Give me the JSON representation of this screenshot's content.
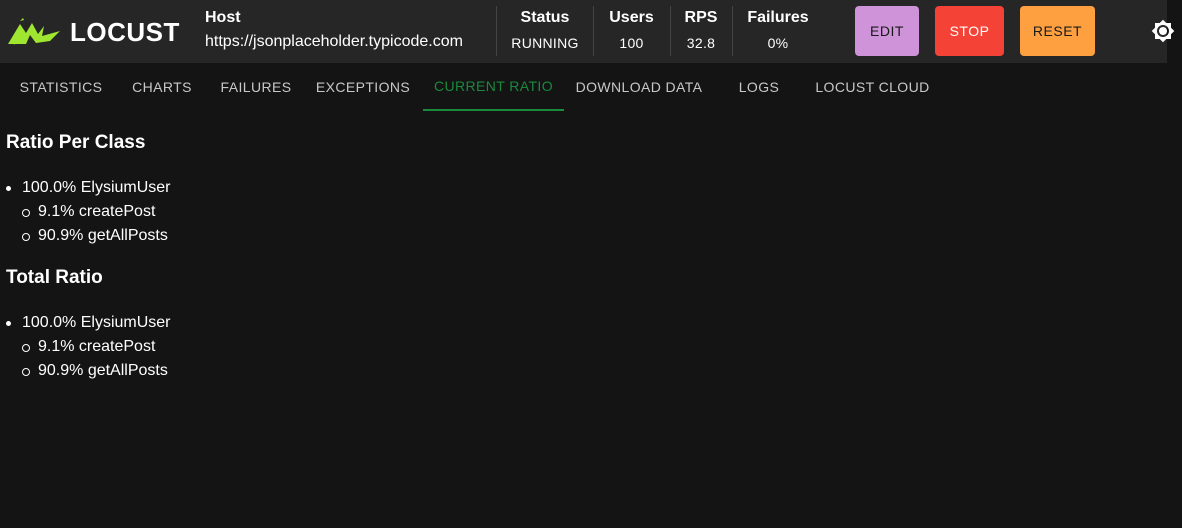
{
  "app": {
    "logo_text": "LOCUST"
  },
  "header": {
    "host": {
      "label": "Host",
      "value": "https://jsonplaceholder.typicode.com"
    },
    "status": {
      "label": "Status",
      "value": "RUNNING"
    },
    "users": {
      "label": "Users",
      "value": "100"
    },
    "rps": {
      "label": "RPS",
      "value": "32.8"
    },
    "failures": {
      "label": "Failures",
      "value": "0%"
    }
  },
  "buttons": {
    "edit": "EDIT",
    "stop": "STOP",
    "reset": "RESET"
  },
  "colors": {
    "edit": "#ce93d8",
    "stop": "#f44336",
    "reset": "#ffa040",
    "accent": "#1a8a3d",
    "logo": "#9ee62f"
  },
  "icons": {
    "theme_toggle": "brightness-icon",
    "logo": "locust-logo-icon"
  },
  "tabs": [
    {
      "label": "STATISTICS",
      "active": false
    },
    {
      "label": "CHARTS",
      "active": false
    },
    {
      "label": "FAILURES",
      "active": false
    },
    {
      "label": "EXCEPTIONS",
      "active": false
    },
    {
      "label": "CURRENT RATIO",
      "active": true
    },
    {
      "label": "DOWNLOAD DATA",
      "active": false
    },
    {
      "label": "LOGS",
      "active": false
    },
    {
      "label": "LOCUST CLOUD",
      "active": false
    }
  ],
  "ratio_per_class": {
    "title": "Ratio Per Class",
    "user": "100.0% ElysiumUser",
    "tasks": [
      "9.1% createPost",
      "90.9% getAllPosts"
    ]
  },
  "total_ratio": {
    "title": "Total Ratio",
    "user": "100.0% ElysiumUser",
    "tasks": [
      "9.1% createPost",
      "90.9% getAllPosts"
    ]
  }
}
